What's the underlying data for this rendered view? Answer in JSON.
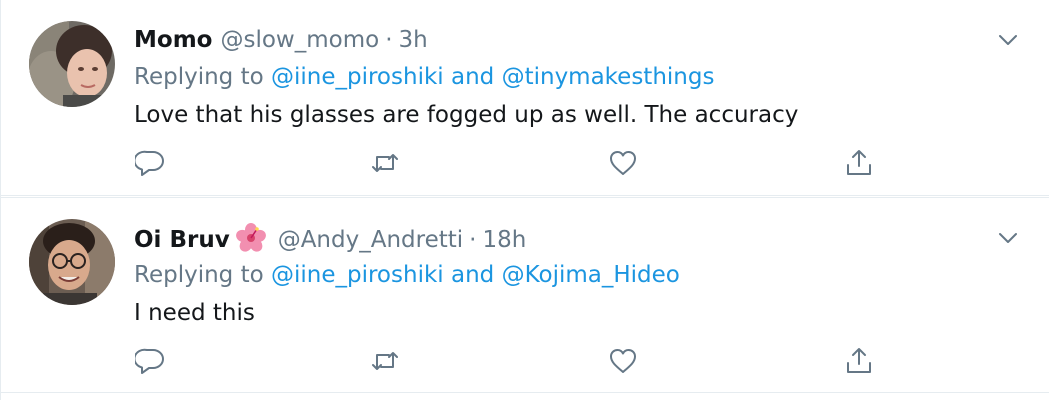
{
  "tweets": [
    {
      "display_name": "Momo",
      "handle": "@slow_momo",
      "separator": "·",
      "time": "3h",
      "replying_prefix": "Replying to",
      "reply_to_1": "@iine_piroshiki",
      "reply_conjunction": "and",
      "reply_to_2": "@tinymakesthings",
      "text": "Love that his glasses are fogged up as well. The accuracy",
      "icons": [
        "reply-icon",
        "retweet-icon",
        "like-icon",
        "share-icon",
        "chevron-down-icon"
      ]
    },
    {
      "display_name": "Oi Bruv",
      "name_emoji": "hibiscus-emoji",
      "handle": "@Andy_Andretti",
      "separator": "·",
      "time": "18h",
      "replying_prefix": "Replying to",
      "reply_to_1": "@iine_piroshiki",
      "reply_conjunction": "and",
      "reply_to_2": "@Kojima_Hideo",
      "text": "I need this",
      "icons": [
        "reply-icon",
        "retweet-icon",
        "like-icon",
        "share-icon",
        "chevron-down-icon"
      ]
    }
  ],
  "colors": {
    "text": "#14171a",
    "secondary": "#657786",
    "link": "#1b95e0",
    "divider": "#e6ecf0"
  }
}
